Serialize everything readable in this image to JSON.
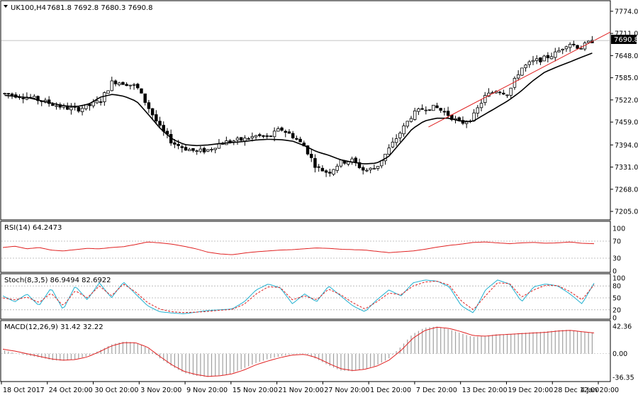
{
  "header": {
    "symbol_label": "UK100,H4",
    "ohlc_label": "7681.8 7692.8 7680.3 7690.8"
  },
  "colors": {
    "background": "#ffffff",
    "frame": "#000000",
    "candle": "#000000",
    "ma_line": "#000000",
    "trendline": "#e02020",
    "rsi_line": "#e02020",
    "stoch_main": "#20b0d0",
    "stoch_signal": "#e02020",
    "macd_signal": "#e02020",
    "macd_hist": "#a0a0a0",
    "level_line": "#b0b0b0",
    "price_tag_bg": "#000000",
    "price_tag_text": "#ffffff"
  },
  "chart_data": [
    {
      "type": "candlestick",
      "panel": "main",
      "title": "UK100,H4",
      "last_price_label": "7690.8",
      "last_price": 7690.8,
      "ylim": [
        7185,
        7800
      ],
      "y_ticks": [
        7774.0,
        7711.0,
        7648.0,
        7585.0,
        7522.0,
        7459.0,
        7394.0,
        7331.0,
        7268.0,
        7205.0
      ],
      "y_tick_labels": [
        "7774.0",
        "7711.0",
        "7648.0",
        "7585.0",
        "7522.0",
        "7459.0",
        "7394.0",
        "7331.0",
        "7268.0",
        "7205.0"
      ],
      "x_labels": [
        "18 Oct 2017",
        "24 Oct 20:00",
        "30 Oct 20:00",
        "3 Nov 20:00",
        "9 Nov 20:00",
        "15 Nov 20:00",
        "21 Nov 20:00",
        "27 Nov 20:00",
        "1 Dec 20:00",
        "7 Dec 20:00",
        "13 Dec 20:00",
        "19 Dec 20:00",
        "28 Dec 12:00",
        "4 Jan 20:00"
      ],
      "close_anchors": [
        7540,
        7535,
        7530,
        7520,
        7510,
        7500,
        7495,
        7505,
        7520,
        7575,
        7570,
        7560,
        7500,
        7440,
        7400,
        7385,
        7375,
        7380,
        7400,
        7405,
        7410,
        7420,
        7415,
        7440,
        7420,
        7390,
        7330,
        7315,
        7345,
        7350,
        7320,
        7330,
        7380,
        7430,
        7480,
        7500,
        7500,
        7480,
        7455,
        7470,
        7530,
        7550,
        7540,
        7610,
        7630,
        7640,
        7655,
        7685,
        7670,
        7690
      ],
      "moving_average_anchors": [
        7535,
        7532,
        7528,
        7520,
        7512,
        7505,
        7503,
        7510,
        7530,
        7538,
        7532,
        7518,
        7480,
        7440,
        7410,
        7395,
        7392,
        7394,
        7398,
        7401,
        7404,
        7408,
        7410,
        7409,
        7405,
        7392,
        7375,
        7365,
        7352,
        7345,
        7340,
        7342,
        7360,
        7400,
        7440,
        7462,
        7470,
        7470,
        7462,
        7460,
        7480,
        7500,
        7520,
        7545,
        7575,
        7600,
        7615,
        7628,
        7642,
        7655
      ],
      "trendline": {
        "from": {
          "bar": 0.72,
          "price": 7445
        },
        "to": {
          "bar": 1.0,
          "price": 7715
        }
      },
      "bars": 160
    },
    {
      "type": "line",
      "panel": "rsi",
      "title": "RSI(14) 64.2473",
      "series": [
        {
          "values": [
            55,
            58,
            52,
            55,
            49,
            47,
            50,
            53,
            52,
            55,
            57,
            62,
            68,
            66,
            63,
            58,
            52,
            44,
            40,
            38,
            42,
            45,
            47,
            49,
            50,
            52,
            54,
            53,
            51,
            50,
            49,
            46,
            43,
            45,
            47,
            51,
            56,
            60,
            63,
            67,
            68,
            66,
            64,
            66,
            67,
            65,
            66,
            68,
            65,
            64
          ]
        }
      ],
      "levels": [
        70,
        30
      ],
      "y_ticks": [
        100,
        70,
        30,
        0
      ],
      "y_tick_labels": [
        "100",
        "70",
        "30",
        "0"
      ],
      "ylim": [
        0,
        100
      ]
    },
    {
      "type": "line",
      "panel": "stochastic",
      "title": "Stoch(8,3,5) 86.9494 82.6922",
      "series": [
        {
          "values": [
            55,
            40,
            60,
            30,
            75,
            20,
            80,
            45,
            88,
            50,
            90,
            60,
            30,
            15,
            12,
            10,
            14,
            18,
            20,
            22,
            40,
            70,
            85,
            75,
            35,
            60,
            40,
            80,
            55,
            30,
            15,
            45,
            70,
            55,
            88,
            95,
            92,
            78,
            30,
            12,
            70,
            95,
            85,
            40,
            78,
            85,
            80,
            60,
            35,
            87
          ]
        },
        {
          "values": [
            50,
            45,
            52,
            38,
            62,
            30,
            68,
            50,
            80,
            55,
            85,
            65,
            38,
            22,
            15,
            13,
            14,
            16,
            19,
            21,
            34,
            60,
            78,
            76,
            45,
            55,
            45,
            72,
            58,
            38,
            22,
            40,
            62,
            58,
            80,
            90,
            92,
            82,
            42,
            20,
            55,
            88,
            86,
            52,
            70,
            82,
            81,
            66,
            45,
            83
          ]
        }
      ],
      "levels": [
        80,
        50,
        20
      ],
      "y_ticks": [
        100,
        80,
        50,
        20,
        0
      ],
      "y_tick_labels": [
        "100",
        "80",
        "50",
        "20",
        "0"
      ],
      "ylim": [
        0,
        100
      ]
    },
    {
      "type": "bar+line",
      "panel": "macd",
      "title": "MACD(12,26,9) 31.42 32.22",
      "series": [
        {
          "name": "histogram",
          "values": [
            5,
            0,
            -3,
            -6,
            -10,
            -11,
            -8,
            -3,
            6,
            15,
            19,
            17,
            8,
            -8,
            -20,
            -30,
            -34,
            -36,
            -34,
            -30,
            -22,
            -14,
            -8,
            -4,
            -1,
            0,
            -8,
            -18,
            -26,
            -27,
            -24,
            -18,
            -8,
            10,
            30,
            40,
            42,
            38,
            32,
            26,
            27,
            30,
            30,
            32,
            33,
            34,
            36,
            37,
            34,
            33
          ]
        },
        {
          "name": "signal",
          "values": [
            7,
            4,
            0,
            -4,
            -8,
            -10,
            -9,
            -5,
            3,
            12,
            17,
            17,
            10,
            -4,
            -17,
            -27,
            -32,
            -35,
            -34,
            -31,
            -25,
            -17,
            -11,
            -6,
            -2,
            -1,
            -6,
            -15,
            -23,
            -26,
            -24,
            -19,
            -10,
            5,
            24,
            36,
            41,
            39,
            34,
            28,
            27,
            29,
            30,
            31,
            32,
            33,
            35,
            36,
            34,
            32
          ]
        }
      ],
      "y_ticks": [
        42.36,
        0,
        -36.35
      ],
      "y_tick_labels": [
        "42.36",
        "0.00",
        "-36.35"
      ],
      "ylim": [
        -36.35,
        42.36
      ]
    }
  ]
}
